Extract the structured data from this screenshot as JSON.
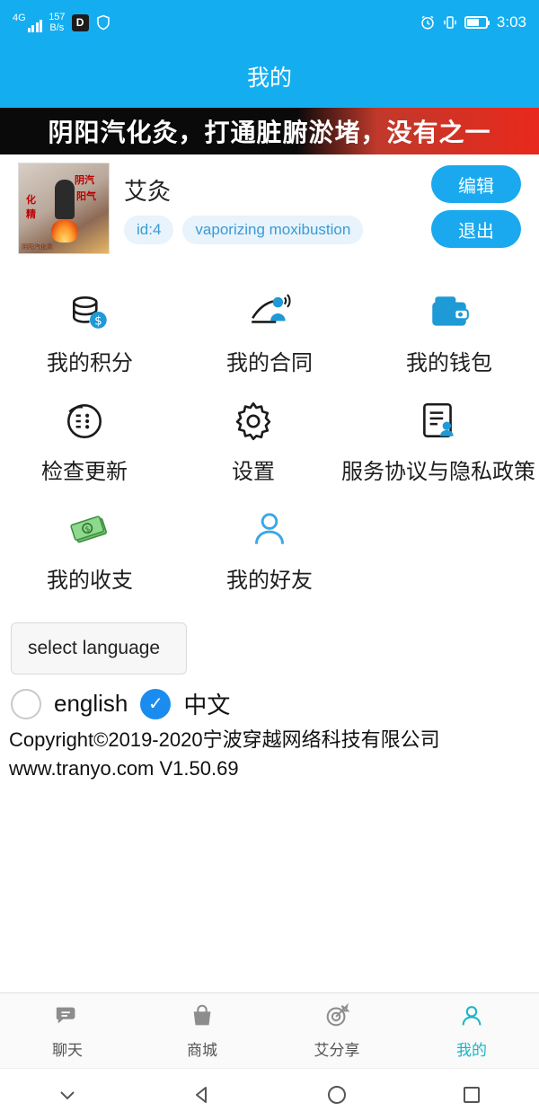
{
  "status_bar": {
    "network_type": "4G",
    "net_speed_value": "157",
    "net_speed_unit": "B/s",
    "hd_icon": "hd-icon",
    "shield_icon": "shield-icon",
    "alarm_icon": "alarm-icon",
    "vibrate_icon": "vibrate-icon",
    "battery_icon": "battery-icon",
    "time": "3:03"
  },
  "header": {
    "title": "我的"
  },
  "banner": {
    "text": "阴阳汽化灸，打通脏腑淤堵，没有之一"
  },
  "profile": {
    "avatar_alt": "moxibustion-avatar",
    "nickname": "艾灸",
    "id_tag": "id:4",
    "desc_tag": "vaporizing moxibustion",
    "edit_label": "编辑",
    "logout_label": "退出"
  },
  "menu": {
    "rows": [
      [
        {
          "label": "我的积分",
          "icon": "coins-icon"
        },
        {
          "label": "我的合同",
          "icon": "contract-icon"
        },
        {
          "label": "我的钱包",
          "icon": "wallet-icon"
        }
      ],
      [
        {
          "label": "检查更新",
          "icon": "update-icon"
        },
        {
          "label": "设置",
          "icon": "gear-icon"
        },
        {
          "label": "服务协议与隐私政策",
          "icon": "policy-icon"
        }
      ],
      [
        {
          "label": "我的收支",
          "icon": "money-icon"
        },
        {
          "label": "我的好友",
          "icon": "person-icon"
        }
      ]
    ]
  },
  "language": {
    "select_label": "select language",
    "options": [
      {
        "label": "english",
        "selected": false
      },
      {
        "label": "中文",
        "selected": true
      }
    ]
  },
  "footer": {
    "copyright_line1": "Copyright©2019-2020宁波穿越网络科技有限公司",
    "copyright_line2": "www.tranyo.com V1.50.69"
  },
  "tabbar": {
    "items": [
      {
        "label": "聊天",
        "icon": "chat-icon",
        "active": false
      },
      {
        "label": "商城",
        "icon": "shop-icon",
        "active": false
      },
      {
        "label": "艾分享",
        "icon": "target-icon",
        "active": false
      },
      {
        "label": "我的",
        "icon": "person-icon",
        "active": true
      }
    ]
  },
  "navbar": {
    "items": [
      {
        "icon": "chevron-down-icon"
      },
      {
        "icon": "back-triangle-icon"
      },
      {
        "icon": "home-circle-icon"
      },
      {
        "icon": "recents-square-icon"
      }
    ]
  },
  "colors": {
    "primary": "#14AEF0",
    "accent": "#1aa9ef",
    "tab_active": "#18b6c4",
    "banner_red": "#e8291c"
  }
}
